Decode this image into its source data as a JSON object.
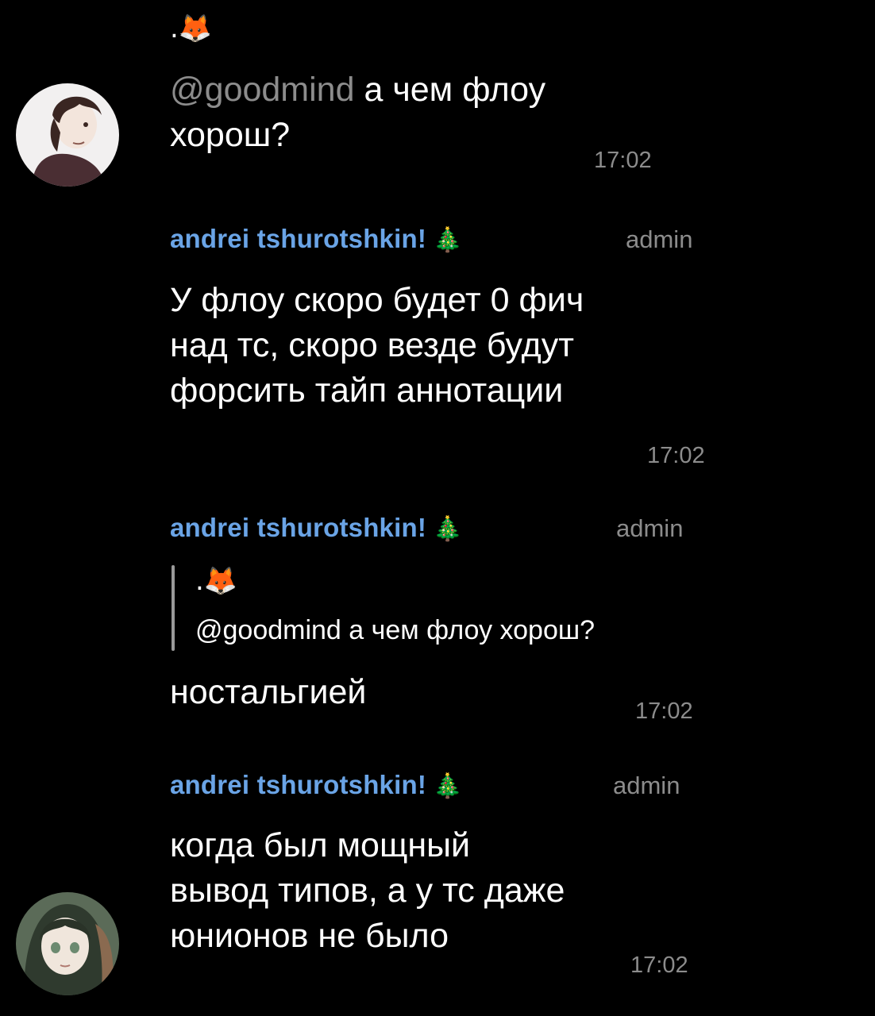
{
  "messages": [
    {
      "prefix": ".🦊",
      "mention": "@goodmind",
      "text": " а чем флоу хорош?",
      "time": "17:02"
    },
    {
      "sender": "andrei tshurotshkin!",
      "badge": "🎄",
      "role": "admin",
      "text": "У флоу скоро будет 0 фич\nнад тс, скоро везде будут\nфорсить тайп аннотации",
      "time": "17:02"
    },
    {
      "sender": "andrei tshurotshkin!",
      "badge": "🎄",
      "role": "admin",
      "reply": {
        "prefix": ".🦊",
        "text": "@goodmind а чем флоу хорош?"
      },
      "text": "ностальгией",
      "time": "17:02"
    },
    {
      "sender": "andrei tshurotshkin!",
      "badge": "🎄",
      "role": "admin",
      "text": "когда был мощный\nвывод типов, а у тс даже\nюнионов не было",
      "time": "17:02"
    }
  ],
  "avatars": [
    "boy-avatar",
    "girl-avatar"
  ]
}
